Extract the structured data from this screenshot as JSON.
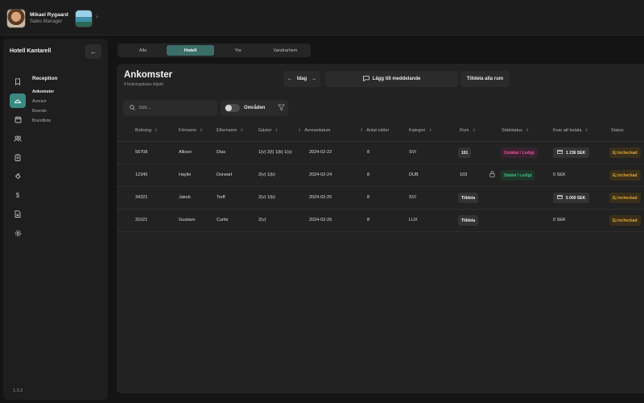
{
  "user": {
    "name": "Mikael Rygaard",
    "role": "Sales Manager"
  },
  "sidebar": {
    "hotel_name": "Hotell Kantarell",
    "section_title": "Reception",
    "items": [
      {
        "label": "Ankomster",
        "active": true
      },
      {
        "label": "Avresor",
        "active": false
      },
      {
        "label": "Boende",
        "active": false
      },
      {
        "label": "Brandlista",
        "active": false
      }
    ],
    "version": "1.3.2"
  },
  "tabs": [
    {
      "label": "Alla",
      "active": false
    },
    {
      "label": "Hotell",
      "active": true
    },
    {
      "label": "Yta",
      "active": false
    },
    {
      "label": "Vandrarhem",
      "active": false
    }
  ],
  "header": {
    "title": "Ankomster",
    "subtitle": "4 bokningsbara objekt",
    "date_label": "Idag",
    "message_button": "Lägg till meddelande",
    "assign_button": "Tilldela alla rum"
  },
  "filters": {
    "search_placeholder": "Sök...",
    "areas_label": "Områden"
  },
  "table": {
    "columns": [
      "Bokning",
      "Förnamn",
      "Efternamn",
      "Gäster",
      "Avresedatum",
      "Antal nätter",
      "Kategori",
      "Rum",
      "Städstatus",
      "Kvar att betala",
      "Status"
    ],
    "rows": [
      {
        "booking": "56708",
        "first": "Allison",
        "last": "Dias",
        "guests": "1(v) 2(t) 1(b) 1(s)",
        "departure": "2024-02-22",
        "nights": "8",
        "category": "SVI",
        "room": "101",
        "room_chip": true,
        "locked": false,
        "clean": "Ostädat / Ledigt",
        "clean_type": "dirty",
        "pay": "1 236 SEK",
        "pay_chip": true,
        "status": "Ej incheckad"
      },
      {
        "booking": "12345",
        "first": "Haylie",
        "last": "Dorwart",
        "guests": "2(v) 1(b)",
        "departure": "2024-02-24",
        "nights": "8",
        "category": "DUB",
        "room": "103",
        "room_chip": false,
        "locked": true,
        "clean": "Städat / Ledigt",
        "clean_type": "clean",
        "pay": "0 SEK",
        "pay_chip": false,
        "status": "Ej incheckad"
      },
      {
        "booking": "34321",
        "first": "Jakob",
        "last": "Torff",
        "guests": "2(v) 1(b)",
        "departure": "2024-02-25",
        "nights": "8",
        "category": "SVI",
        "room": "Tilldela",
        "room_chip": true,
        "locked": false,
        "clean": "",
        "clean_type": "",
        "pay": "5 000 SEK",
        "pay_chip": true,
        "status": "Ej incheckad"
      },
      {
        "booking": "31021",
        "first": "Gustavo",
        "last": "Curtis",
        "guests": "2(v)",
        "departure": "2024-02-26",
        "nights": "8",
        "category": "LUX",
        "room": "Tilldela",
        "room_chip": true,
        "locked": false,
        "clean": "",
        "clean_type": "",
        "pay": "0 SEK",
        "pay_chip": false,
        "status": "Ej incheckad"
      }
    ]
  },
  "colors": {
    "accent": "#3a8a80",
    "dirty_text": "#e0559a",
    "dirty_bg": "#3a2230",
    "clean_text": "#3fbf86",
    "clean_bg": "#1f3529",
    "status_text": "#e0a73a",
    "status_bg": "#3a2f1a"
  }
}
